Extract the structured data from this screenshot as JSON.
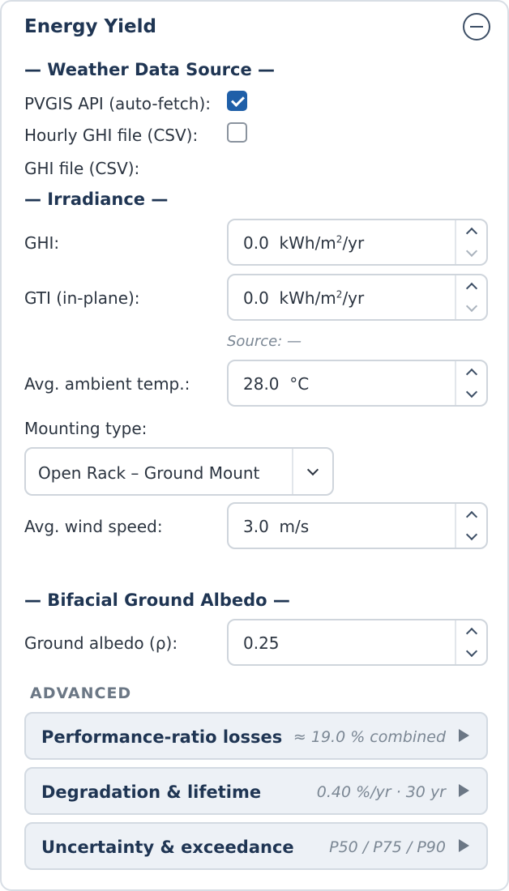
{
  "panel": {
    "title": "Energy Yield",
    "collapse_icon": "minus-circle-icon"
  },
  "weather": {
    "heading": "— Weather Data Source —",
    "pvgis_label": "PVGIS API (auto-fetch):",
    "pvgis_checked": true,
    "hourly_label": "Hourly GHI file (CSV):",
    "hourly_checked": false,
    "ghi_file_label": "GHI file (CSV):"
  },
  "irradiance": {
    "heading": "— Irradiance —",
    "ghi_label": "GHI:",
    "ghi_value": "0.0",
    "ghi_unit_pre": "kWh/m",
    "ghi_unit_sup": "2",
    "ghi_unit_post": "/yr",
    "gti_label": "GTI (in-plane):",
    "gti_value": "0.0",
    "gti_unit_pre": "kWh/m",
    "gti_unit_sup": "2",
    "gti_unit_post": "/yr",
    "source_note": "Source: —",
    "temp_label": "Avg. ambient temp.:",
    "temp_value": "28.0",
    "temp_unit": "°C",
    "mounting_label": "Mounting type:",
    "mounting_value": "Open Rack – Ground Mount",
    "wind_label": "Avg. wind speed:",
    "wind_value": "3.0",
    "wind_unit": "m/s"
  },
  "albedo": {
    "heading": "— Bifacial Ground Albedo —",
    "label": "Ground albedo (ρ):",
    "value": "0.25"
  },
  "advanced": {
    "heading": "ADVANCED",
    "items": [
      {
        "name": "Performance-ratio losses",
        "summary": "≈ 19.0 % combined"
      },
      {
        "name": "Degradation & lifetime",
        "summary": "0.40 %/yr · 30 yr"
      },
      {
        "name": "Uncertainty & exceedance",
        "summary": "P50 / P75 / P90"
      }
    ]
  },
  "colors": {
    "accent": "#1f5fa8",
    "heading": "#1f3553",
    "muted": "#7b8794"
  }
}
